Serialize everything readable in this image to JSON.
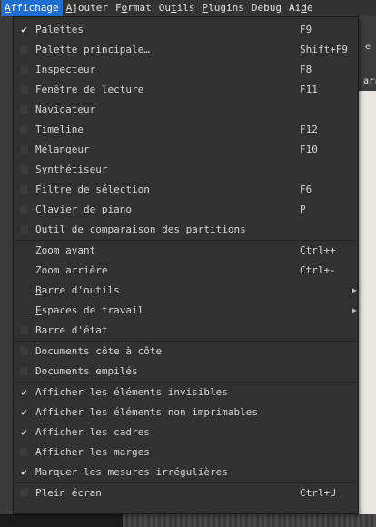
{
  "menubar": {
    "items": [
      {
        "label": "Affichage",
        "active": true
      },
      {
        "label": "Ajouter"
      },
      {
        "label": "Format"
      },
      {
        "label": "Outils"
      },
      {
        "label": "Plugins"
      },
      {
        "label": "Debug"
      },
      {
        "label": "Aide"
      }
    ]
  },
  "background": {
    "frag_e": "e",
    "frag_arr": "arr"
  },
  "menu": {
    "items": [
      {
        "label": "Palettes",
        "checked": true,
        "shortcut": "F9"
      },
      {
        "label": "Palette principale…",
        "checked": false,
        "shortcut": "Shift+F9"
      },
      {
        "label": "Inspecteur",
        "checked": false,
        "shortcut": "F8"
      },
      {
        "label": "Fenêtre de lecture",
        "checked": false,
        "shortcut": "F11"
      },
      {
        "label": "Navigateur",
        "checked": false,
        "shortcut": ""
      },
      {
        "label": "Timeline",
        "checked": false,
        "shortcut": "F12"
      },
      {
        "label": "Mélangeur",
        "checked": false,
        "shortcut": "F10"
      },
      {
        "label": "Synthétiseur",
        "checked": false,
        "shortcut": ""
      },
      {
        "label": "Filtre de sélection",
        "checked": false,
        "shortcut": "F6"
      },
      {
        "label": "Clavier de piano",
        "checked": false,
        "shortcut": "P"
      },
      {
        "label": "Outil de comparaison des partitions",
        "checked": false,
        "shortcut": ""
      },
      {
        "separator": true
      },
      {
        "label": "Zoom avant",
        "noCheck": true,
        "shortcut": "Ctrl++"
      },
      {
        "label": "Zoom arrière",
        "noCheck": true,
        "shortcut": "Ctrl+-"
      },
      {
        "label": "Barre d'outils",
        "noCheck": true,
        "submenu": true
      },
      {
        "label": "Espaces de travail",
        "noCheck": true,
        "submenu": true
      },
      {
        "label": "Barre d'état",
        "checked": false
      },
      {
        "separator": true
      },
      {
        "label": "Documents côte à côte",
        "checked": false
      },
      {
        "label": "Documents empilés",
        "checked": false
      },
      {
        "separator": true
      },
      {
        "label": "Afficher les éléments invisibles",
        "checked": true
      },
      {
        "label": "Afficher les éléments non imprimables",
        "checked": true
      },
      {
        "label": "Afficher les cadres",
        "checked": true
      },
      {
        "label": "Afficher les marges",
        "checked": false
      },
      {
        "label": "Marquer les mesures irrégulières",
        "checked": true
      },
      {
        "separator": true
      },
      {
        "label": "Plein écran",
        "checked": false,
        "shortcut": "Ctrl+U"
      }
    ]
  }
}
